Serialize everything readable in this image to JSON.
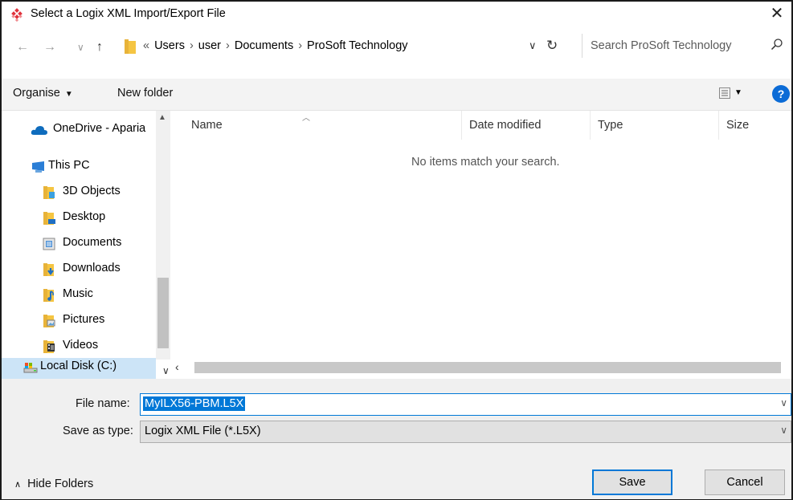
{
  "window": {
    "title": "Select a Logix XML Import/Export File",
    "close_glyph": "✕"
  },
  "address_bar": {
    "back_glyph": "←",
    "forward_glyph": "→",
    "recent_glyph": "∨",
    "up_glyph": "↑",
    "overflow_glyph": "«",
    "breadcrumbs": [
      "Users",
      "user",
      "Documents",
      "ProSoft Technology"
    ],
    "dropdown_glyph": "∨",
    "refresh_glyph": "↻"
  },
  "search": {
    "placeholder": "Search ProSoft Technology"
  },
  "toolbar": {
    "organise_label": "Organise",
    "new_folder_label": "New folder",
    "help_label": "?"
  },
  "nav_pane": {
    "items": [
      {
        "label": "OneDrive - Aparia",
        "icon": "cloud-icon"
      },
      {
        "label": "This PC",
        "icon": "computer-icon"
      },
      {
        "label": "3D Objects",
        "icon": "3d-objects-folder-icon"
      },
      {
        "label": "Desktop",
        "icon": "desktop-folder-icon"
      },
      {
        "label": "Documents",
        "icon": "documents-folder-icon"
      },
      {
        "label": "Downloads",
        "icon": "downloads-folder-icon"
      },
      {
        "label": "Music",
        "icon": "music-folder-icon"
      },
      {
        "label": "Pictures",
        "icon": "pictures-folder-icon"
      },
      {
        "label": "Videos",
        "icon": "videos-folder-icon"
      },
      {
        "label": "Local Disk (C:)",
        "icon": "drive-icon",
        "selected": true
      }
    ]
  },
  "file_list": {
    "columns": [
      "Name",
      "Date modified",
      "Type",
      "Size"
    ],
    "empty_message": "No items match your search."
  },
  "form": {
    "file_name_label": "File name:",
    "file_name_value": "MyILX56-PBM.L5X",
    "save_type_label": "Save as type:",
    "save_type_value": "Logix XML File (*.L5X)"
  },
  "footer": {
    "hide_folders_label": "Hide Folders",
    "save_label": "Save",
    "cancel_label": "Cancel"
  },
  "colors": {
    "accent": "#0078d7",
    "selection": "#cce4f7",
    "help_blue": "#0b6bd6",
    "folder_yellow": "#f5c542",
    "logo_red": "#e0323c"
  }
}
